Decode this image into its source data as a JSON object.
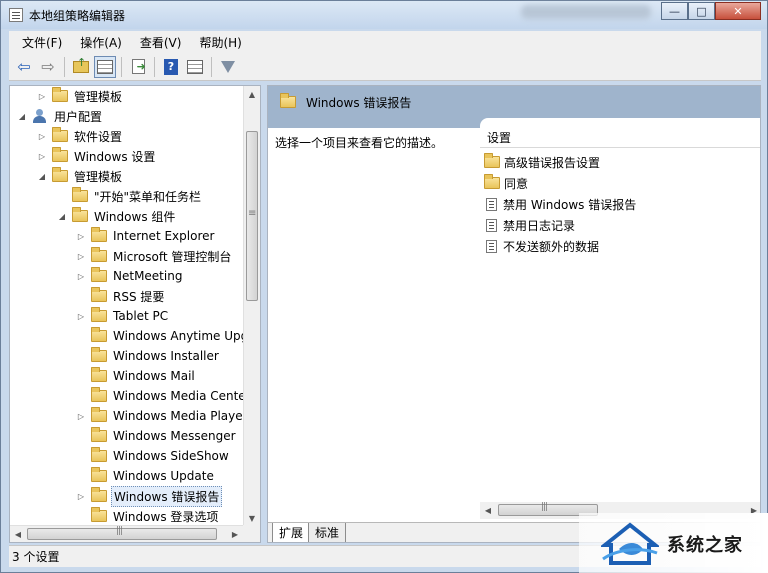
{
  "window": {
    "title": "本地组策略编辑器",
    "buttons": {
      "minimize": "—",
      "maximize": "□",
      "close": "✕"
    }
  },
  "menubar": {
    "items": [
      {
        "label": "文件(F)"
      },
      {
        "label": "操作(A)"
      },
      {
        "label": "查看(V)"
      },
      {
        "label": "帮助(H)"
      }
    ]
  },
  "toolbar": {
    "icons": [
      "back-arrow-icon",
      "forward-arrow-icon",
      "up-folder-icon",
      "show-hide-tree-icon",
      "export-list-icon",
      "help-icon",
      "properties-icon",
      "filter-icon"
    ],
    "help_glyph": "?"
  },
  "tree": {
    "items": [
      {
        "label": "管理模板",
        "icon": "folder-icon",
        "expander": "▷"
      },
      {
        "label": "用户配置",
        "icon": "user-icon",
        "expander": "◢"
      },
      {
        "label": "软件设置",
        "icon": "folder-icon",
        "expander": "▷"
      },
      {
        "label": "Windows 设置",
        "icon": "folder-icon",
        "expander": "▷"
      },
      {
        "label": "管理模板",
        "icon": "folder-icon",
        "expander": "◢"
      },
      {
        "label": "\"开始\"菜单和任务栏",
        "icon": "folder-icon",
        "expander": ""
      },
      {
        "label": "Windows 组件",
        "icon": "folder-icon",
        "expander": "◢"
      },
      {
        "label": "Internet Explorer",
        "icon": "folder-icon",
        "expander": "▷"
      },
      {
        "label": "Microsoft 管理控制台",
        "icon": "folder-icon",
        "expander": "▷"
      },
      {
        "label": "NetMeeting",
        "icon": "folder-icon",
        "expander": "▷"
      },
      {
        "label": "RSS 提要",
        "icon": "folder-icon",
        "expander": ""
      },
      {
        "label": "Tablet PC",
        "icon": "folder-icon",
        "expander": "▷"
      },
      {
        "label": "Windows Anytime Upgr",
        "icon": "folder-icon",
        "expander": ""
      },
      {
        "label": "Windows Installer",
        "icon": "folder-icon",
        "expander": ""
      },
      {
        "label": "Windows Mail",
        "icon": "folder-icon",
        "expander": ""
      },
      {
        "label": "Windows Media Center",
        "icon": "folder-icon",
        "expander": ""
      },
      {
        "label": "Windows Media Player",
        "icon": "folder-icon",
        "expander": "▷"
      },
      {
        "label": "Windows Messenger",
        "icon": "folder-icon",
        "expander": ""
      },
      {
        "label": "Windows SideShow",
        "icon": "folder-icon",
        "expander": ""
      },
      {
        "label": "Windows Update",
        "icon": "folder-icon",
        "expander": ""
      },
      {
        "label": "Windows 错误报告",
        "icon": "folder-icon",
        "expander": "▷",
        "selected": true
      },
      {
        "label": "Windows 登录选项",
        "icon": "folder-icon",
        "expander": ""
      }
    ],
    "scroll": {
      "up": "▲",
      "down": "▼",
      "left": "◀",
      "right": "▶"
    }
  },
  "details": {
    "header_title": "Windows 错误报告",
    "description": "选择一个项目来查看它的描述。",
    "column_header": "设置",
    "items": [
      {
        "label": "高级错误报告设置",
        "icon": "folder-icon"
      },
      {
        "label": "同意",
        "icon": "folder-icon"
      },
      {
        "label": "禁用 Windows 错误报告",
        "icon": "policy-setting-icon"
      },
      {
        "label": "禁用日志记录",
        "icon": "policy-setting-icon"
      },
      {
        "label": "不发送额外的数据",
        "icon": "policy-setting-icon"
      }
    ],
    "tabs": [
      {
        "label": "扩展",
        "active": true
      },
      {
        "label": "标准",
        "active": false
      }
    ]
  },
  "statusbar": {
    "text": "3 个设置"
  },
  "watermark": {
    "text": "系统之家"
  },
  "colors": {
    "header_band": "#9fb4cc",
    "window_frame": "#c9d9ec",
    "selection": "#e4eefb"
  }
}
